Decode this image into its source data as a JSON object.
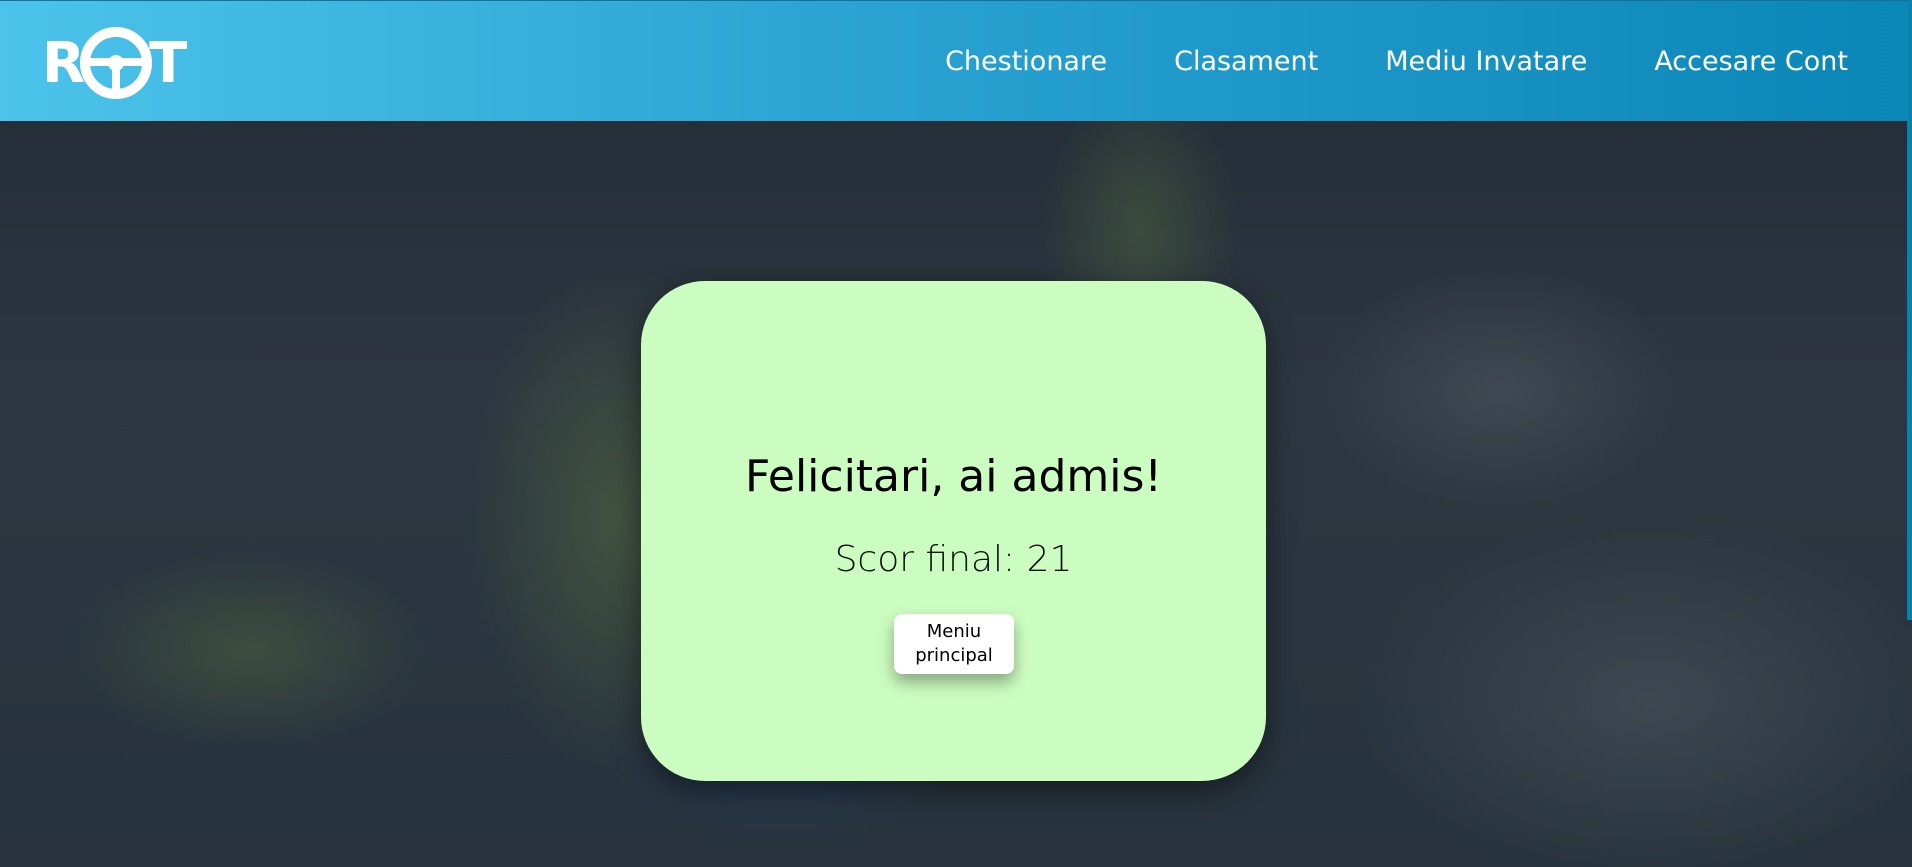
{
  "navbar": {
    "logo": {
      "text_left": "R",
      "text_right": "T",
      "icon": "steering-wheel-icon"
    },
    "links": [
      {
        "label": "Chestionare"
      },
      {
        "label": "Clasament"
      },
      {
        "label": "Mediu Invatare"
      },
      {
        "label": "Accesare Cont"
      }
    ]
  },
  "result": {
    "title": "Felicitari, ai admis!",
    "score_label": "Scor final: ",
    "score_value": "21",
    "button_label": "Meniu principal"
  },
  "colors": {
    "navbar_start": "#4cc3ea",
    "navbar_end": "#0a86b7",
    "card_background": "#ccfdc0",
    "button_background": "#ffffff"
  }
}
